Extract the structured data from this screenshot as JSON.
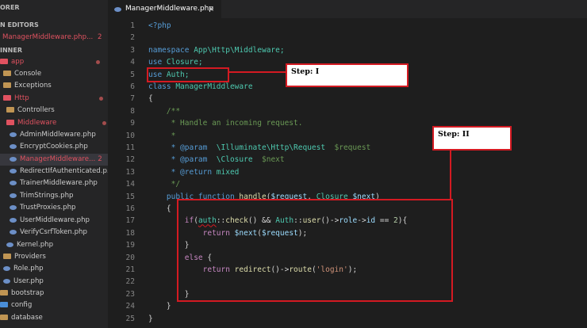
{
  "sidebar": {
    "section_open_editors": "N EDITORS",
    "open_file": "ManagerMiddleware.php...",
    "open_file_badge": "2",
    "section_project": "INNER",
    "header_partial": "ORER",
    "items": [
      {
        "label": "app"
      },
      {
        "label": "Console"
      },
      {
        "label": "Exceptions"
      },
      {
        "label": "Http"
      },
      {
        "label": "Controllers"
      },
      {
        "label": "Middleware"
      },
      {
        "label": "AdminMiddleware.php"
      },
      {
        "label": "EncryptCookies.php"
      },
      {
        "label": "ManagerMiddleware...",
        "badge": "2"
      },
      {
        "label": "RedirectIfAuthenticated.p..."
      },
      {
        "label": "TrainerMiddleware.php"
      },
      {
        "label": "TrimStrings.php"
      },
      {
        "label": "TrustProxies.php"
      },
      {
        "label": "UserMiddleware.php"
      },
      {
        "label": "VerifyCsrfToken.php"
      },
      {
        "label": "Kernel.php"
      },
      {
        "label": "Providers"
      },
      {
        "label": "Role.php"
      },
      {
        "label": "User.php"
      },
      {
        "label": "bootstrap"
      },
      {
        "label": "config"
      },
      {
        "label": "database"
      }
    ]
  },
  "tab": {
    "name": "ManagerMiddleware.php",
    "close": "×"
  },
  "line_numbers": [
    "1",
    "2",
    "3",
    "4",
    "5",
    "6",
    "7",
    "8",
    "9",
    "10",
    "11",
    "12",
    "13",
    "14",
    "15",
    "16",
    "17",
    "18",
    "19",
    "20",
    "21",
    "22",
    "23",
    "24",
    "25"
  ],
  "code": {
    "l1": "<?php",
    "l3a": "namespace",
    "l3b": " App\\Http\\Middleware;",
    "l4a": "use",
    "l4b": " Closure;",
    "l5a": "use",
    "l5b": " Auth;",
    "l6a": "class",
    "l6b": " ManagerMiddleware",
    "l7": "{",
    "l8": "    /**",
    "l9": "     * Handle an incoming request.",
    "l10": "     *",
    "l11a": "     * @param",
    "l11b": "  \\Illuminate\\Http\\Request",
    "l11c": "  $request",
    "l12a": "     * @param",
    "l12b": "  \\Closure",
    "l12c": "  $next",
    "l13a": "     * @return",
    "l13b": " mixed",
    "l14": "     */",
    "l15a": "    public",
    "l15b": " function",
    "l15c": " handle",
    "l15d": "(",
    "l15e": "$request",
    "l15f": ", ",
    "l15g": "Closure",
    "l15h": " $next",
    "l15i": ")",
    "l16": "    {",
    "l17a": "        if",
    "l17b": "(",
    "l17c": "auth",
    "l17d": "::",
    "l17e": "check",
    "l17f": "() && ",
    "l17g": "Auth",
    "l17h": "::",
    "l17i": "user",
    "l17j": "()->",
    "l17k": "role",
    "l17l": "->",
    "l17m": "id",
    "l17n": " == ",
    "l17o": "2",
    "l17p": "){",
    "l18a": "            return",
    "l18b": " $next",
    "l18c": "(",
    "l18d": "$request",
    "l18e": ");",
    "l19": "        }",
    "l20a": "        else",
    "l20b": " {",
    "l21a": "            return",
    "l21b": " redirect",
    "l21c": "()->",
    "l21d": "route",
    "l21e": "(",
    "l21f": "'login'",
    "l21g": ");",
    "l23": "        }",
    "l24": "    }",
    "l25": "}"
  },
  "annotations": {
    "step1": "Step: I",
    "step2": "Step: II"
  },
  "colors": {
    "annotation_red": "#d41a22",
    "keyword": "#569cd6",
    "type": "#4ec9b0",
    "comment": "#6a9955",
    "string": "#ce9178"
  }
}
